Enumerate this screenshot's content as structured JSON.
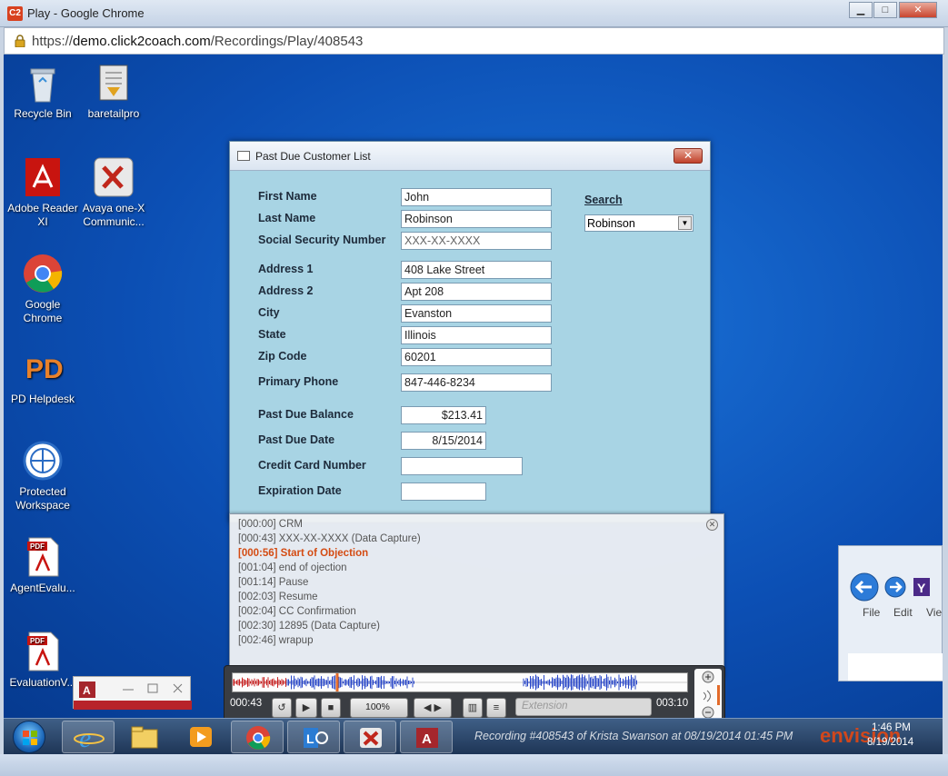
{
  "browser": {
    "logo_text": "C2",
    "title": "Play - Google Chrome",
    "url_scheme": "https://",
    "url_domain": "demo.click2coach.com",
    "url_path": "/Recordings/Play/408543"
  },
  "desktop_icons": [
    {
      "label": "Recycle Bin",
      "icon": "recycle-bin-icon"
    },
    {
      "label": "baretailpro",
      "icon": "baretailpro-icon"
    },
    {
      "label": "Adobe Reader XI",
      "icon": "adobe-reader-icon"
    },
    {
      "label": "Avaya one-X Communic...",
      "icon": "avaya-icon"
    },
    {
      "label": "Google Chrome",
      "icon": "chrome-icon"
    },
    {
      "label": "PD Helpdesk",
      "icon": "pd-helpdesk-icon"
    },
    {
      "label": "Protected Workspace",
      "icon": "protected-workspace-icon"
    },
    {
      "label": "AgentEvalu...",
      "icon": "pdf-icon"
    },
    {
      "label": "EvaluationV...",
      "icon": "pdf-icon"
    }
  ],
  "form": {
    "title": "Past Due Customer List",
    "close_label": "✕",
    "fields": [
      {
        "label": "First Name",
        "value": "John"
      },
      {
        "label": "Last Name",
        "value": "Robinson"
      },
      {
        "label": "Social Security Number",
        "value": "XXX-XX-XXXX"
      },
      {
        "label": "Address 1",
        "value": "408 Lake Street"
      },
      {
        "label": "Address 2",
        "value": "Apt 208"
      },
      {
        "label": "City",
        "value": "Evanston"
      },
      {
        "label": "State",
        "value": "Illinois"
      },
      {
        "label": "Zip Code",
        "value": "60201"
      },
      {
        "label": "Primary Phone",
        "value": "847-446-8234"
      },
      {
        "label": "Past Due Balance",
        "value": "$213.41"
      },
      {
        "label": "Past Due Date",
        "value": "8/15/2014"
      },
      {
        "label": "Credit Card Number",
        "value": ""
      },
      {
        "label": "Expiration Date",
        "value": ""
      }
    ],
    "search_label": "Search",
    "search_value": "Robinson"
  },
  "events": [
    {
      "text": "[000:00] CRM",
      "highlight": false
    },
    {
      "text": "[000:43] XXX-XX-XXXX (Data Capture)",
      "highlight": false
    },
    {
      "text": "[000:56] Start of Objection",
      "highlight": true
    },
    {
      "text": "[001:04] end of ojection",
      "highlight": false
    },
    {
      "text": "[001:14] Pause",
      "highlight": false
    },
    {
      "text": "[002:03] Resume",
      "highlight": false
    },
    {
      "text": "[002:04] CC Confirmation",
      "highlight": false
    },
    {
      "text": "[002:30] 12895 (Data Capture)",
      "highlight": false
    },
    {
      "text": "[002:46] wrapup",
      "highlight": false
    }
  ],
  "player": {
    "current_time": "000:43",
    "total_time": "003:10",
    "zoom": "100%",
    "extension_placeholder": "Extension",
    "progress_fraction": 0.23
  },
  "taskbar": {
    "recording_caption": "Recording #408543 of Krista Swanson at 08/19/2014 01:45 PM",
    "brand": "envision",
    "time": "1:46 PM",
    "date": "8/19/2014"
  },
  "colors": {
    "form_bg": "#a8d4e4",
    "highlight_event": "#d44b12",
    "desktop": "#0c4fb4"
  }
}
